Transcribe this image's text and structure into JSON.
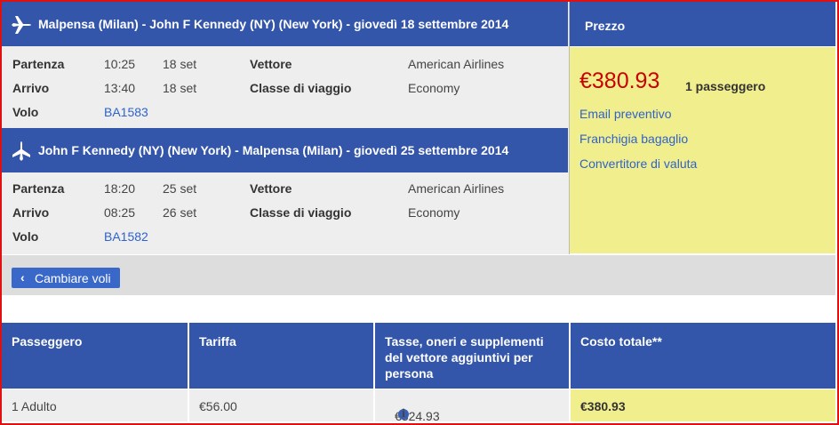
{
  "outbound": {
    "title": "Malpensa (Milan) - John F Kennedy (NY) (New York) - giovedì 18 settembre 2014",
    "departure_label": "Partenza",
    "departure_time": "10:25",
    "departure_date": "18 set",
    "arrival_label": "Arrivo",
    "arrival_time": "13:40",
    "arrival_date": "18 set",
    "flight_label": "Volo",
    "flight_number": "BA1583",
    "carrier_label": "Vettore",
    "carrier": "American Airlines",
    "class_label": "Classe di viaggio",
    "class": "Economy"
  },
  "return": {
    "title": "John F Kennedy (NY) (New York) - Malpensa (Milan) - giovedì 25 settembre 2014",
    "departure_label": "Partenza",
    "departure_time": "18:20",
    "departure_date": "25 set",
    "arrival_label": "Arrivo",
    "arrival_time": "08:25",
    "arrival_date": "26 set",
    "flight_label": "Volo",
    "flight_number": "BA1582",
    "carrier_label": "Vettore",
    "carrier": "American Airlines",
    "class_label": "Classe di viaggio",
    "class": "Economy"
  },
  "price": {
    "header": "Prezzo",
    "amount": "€380.93",
    "passengers": "1 passeggero",
    "links": [
      "Email preventivo",
      "Franchigia bagaglio",
      "Convertitore di valuta"
    ]
  },
  "change_flights_label": "Cambiare voli",
  "table": {
    "headers": [
      "Passeggero",
      "Tariffa",
      "Tasse, oneri e supplementi del vettore aggiuntivi per persona",
      "Costo totale**"
    ],
    "row": [
      "1 Adulto",
      "€56.00",
      "€324.93",
      "€380.93"
    ]
  },
  "colors": {
    "header_blue": "#3355aa",
    "price_red": "#cc0000",
    "price_yellow": "#f1ee8e",
    "link_blue": "#2f63c9",
    "frame_red": "#e01010"
  },
  "icons": {
    "flight": "airplane-icon",
    "back": "chevron-left-icon",
    "info": "info-icon"
  }
}
